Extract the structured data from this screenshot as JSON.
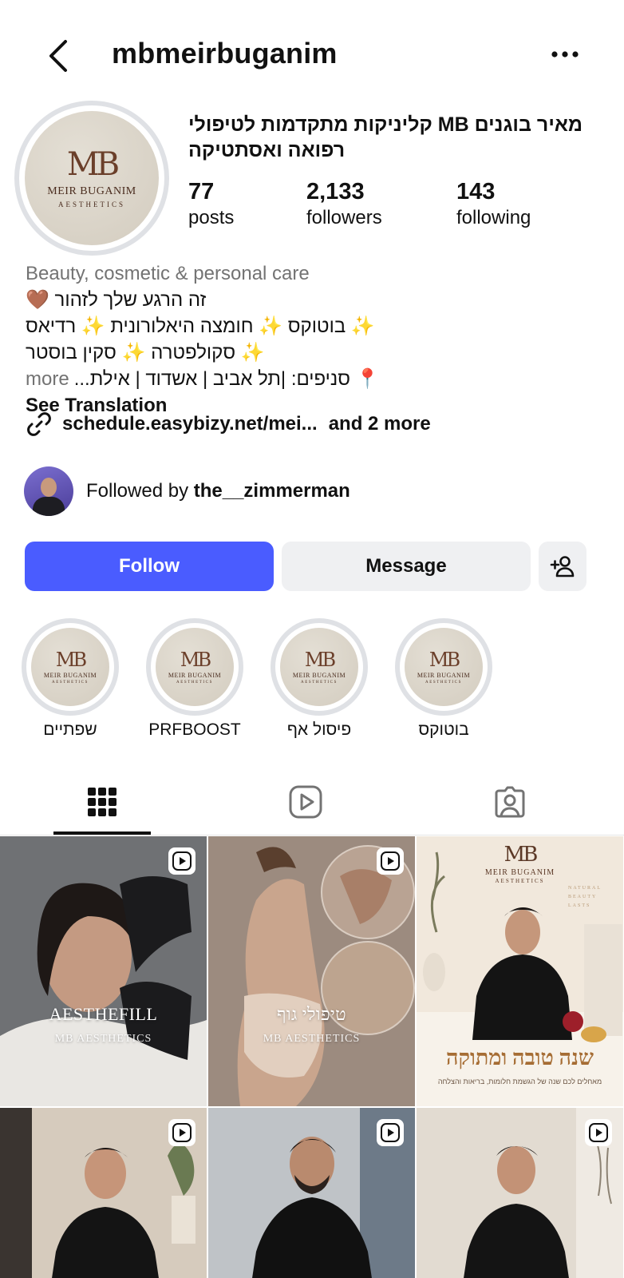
{
  "header": {
    "username": "mbmeirbuganim",
    "back_icon": "chevron-left-icon",
    "more_icon": "more-horizontal-icon"
  },
  "profile": {
    "avatar": {
      "mb": "MB",
      "name": "MEIR BUGANIM",
      "sub": "AESTHETICS"
    },
    "fullname_line1": "מאיר בוגנים MB קליניקות מתקדמות לטיפולי",
    "fullname_line2": "רפואה ואסתטיקה",
    "stats": [
      {
        "value": "77",
        "label": "posts"
      },
      {
        "value": "2,133",
        "label": "followers"
      },
      {
        "value": "143",
        "label": "following"
      }
    ]
  },
  "bio": {
    "category": "Beauty, cosmetic & personal care",
    "line1": "זה הרגע שלך לזהור 🤎",
    "line2": "✨ בוטוקס ✨ חומצה היאלורונית ✨ רדיאס",
    "line3": "✨ סקולפטרה ✨ סקין בוסטר",
    "line4": "📍 סניפים: |תל אביב | אשדוד | אילת...",
    "more": "more",
    "see_translation": "See Translation",
    "link": "schedule.easybizy.net/mei...",
    "link_more": "and 2 more",
    "link_icon": "link-icon"
  },
  "followed_by": {
    "prefix": "Followed by ",
    "user": "the__zimmerman"
  },
  "actions": {
    "follow": "Follow",
    "message": "Message",
    "add_person_icon": "add-person-icon"
  },
  "highlights": [
    {
      "label": "בוטוקס"
    },
    {
      "label": "פיסול אף"
    },
    {
      "label": "PRFBOOST"
    },
    {
      "label": "שפתיים"
    }
  ],
  "tabs": [
    {
      "icon": "grid-icon",
      "active": true
    },
    {
      "icon": "reels-icon",
      "active": false
    },
    {
      "icon": "tagged-icon",
      "active": false
    }
  ],
  "posts": [
    {
      "caption1": "AESTHEFILL",
      "caption2": "MB AESTHETICS",
      "reel": true
    },
    {
      "caption1": "טיפולי גוף",
      "caption2": "MB AESTHETICS",
      "reel": true
    },
    {
      "top_mb": "MB",
      "top_name": "MEIR BUGANIM",
      "top_sub": "AESTHETICS",
      "side": "NATURAL BEAUTY LASTS",
      "heading": "שנה טובה ומתוקה",
      "sub": "מאחלים לכם שנה של הגשמת חלומות, בריאות והצלחה",
      "reel": false
    },
    {
      "reel": true
    },
    {
      "reel": true
    },
    {
      "reel": true
    }
  ]
}
